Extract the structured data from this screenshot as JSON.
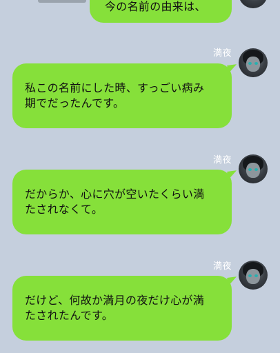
{
  "conversation": {
    "top_message": "今の名前の由来は、",
    "messages": [
      {
        "sender": "満夜",
        "text": "私この名前にした時、すっごい病み\n期でだったんです。"
      },
      {
        "sender": "満夜",
        "text": "だからか、心に穴が空いたくらい満\nたされなくて。"
      },
      {
        "sender": "満夜",
        "text": "だけど、何故か満月の夜だけ心が満\nたされたんです。"
      }
    ]
  },
  "colors": {
    "background": "#c5cfdd",
    "bubble": "#86e03a",
    "sender_name": "#ffffff"
  }
}
